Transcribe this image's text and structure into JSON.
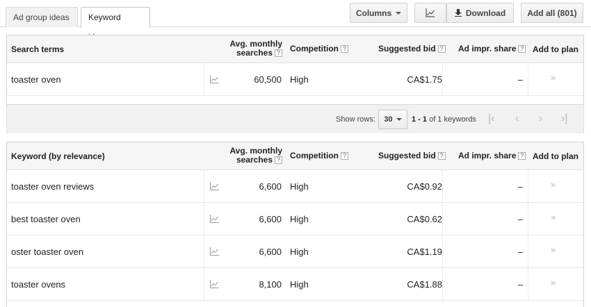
{
  "tabs": {
    "ad_group_ideas": "Ad group ideas",
    "keyword_ideas": "Keyword ideas"
  },
  "toolbar": {
    "columns_label": "Columns",
    "download_label": "Download",
    "add_all_label": "Add all (801)"
  },
  "search_table": {
    "headers": {
      "term": "Search terms",
      "avg_line1": "Avg. monthly",
      "avg_line2": "searches",
      "competition": "Competition",
      "bid": "Suggested bid",
      "impr": "Ad impr. share",
      "plan": "Add to plan"
    },
    "rows": [
      {
        "term": "toaster oven",
        "avg": "60,500",
        "competition": "High",
        "bid": "CA$1.75",
        "impr": "–",
        "plan": "»"
      }
    ]
  },
  "pager": {
    "show_rows_label": "Show rows:",
    "rows_value": "30",
    "range_bold": "1 - 1",
    "range_rest": " of 1 keywords"
  },
  "keyword_table": {
    "headers": {
      "term": "Keyword (by relevance)",
      "avg_line1": "Avg. monthly",
      "avg_line2": "searches",
      "competition": "Competition",
      "bid": "Suggested bid",
      "impr": "Ad impr. share",
      "plan": "Add to plan"
    },
    "rows": [
      {
        "term": "toaster oven reviews",
        "avg": "6,600",
        "competition": "High",
        "bid": "CA$0.92",
        "impr": "–",
        "plan": "»"
      },
      {
        "term": "best toaster oven",
        "avg": "6,600",
        "competition": "High",
        "bid": "CA$0.62",
        "impr": "–",
        "plan": "»"
      },
      {
        "term": "oster toaster oven",
        "avg": "6,600",
        "competition": "High",
        "bid": "CA$1.19",
        "impr": "–",
        "plan": "»"
      },
      {
        "term": "toaster ovens",
        "avg": "8,100",
        "competition": "High",
        "bid": "CA$1.88",
        "impr": "–",
        "plan": "»"
      }
    ]
  },
  "icons": {
    "help": "?",
    "first_page": "|‹",
    "prev_page": "‹",
    "next_page": "›",
    "last_page": "›|"
  },
  "colors": {
    "header_bg": "#f5f5f5",
    "pager_bg": "#f1f1f1",
    "add_arrow": "#b4b4b4"
  }
}
